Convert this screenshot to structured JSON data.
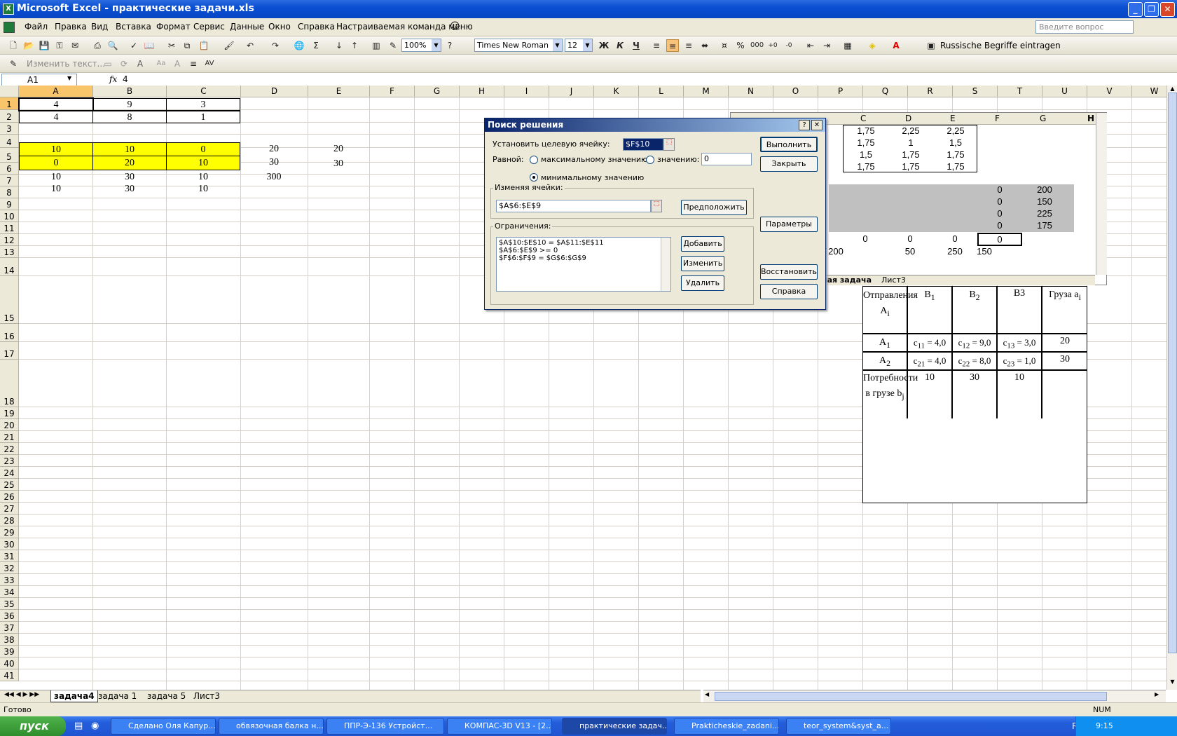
{
  "window": {
    "title": "Microsoft Excel - практические задачи.xls",
    "minimize": "_",
    "restore": "❐",
    "close": "✕"
  },
  "menu": {
    "items": [
      "Файл",
      "Правка",
      "Вид",
      "Вставка",
      "Формат",
      "Сервис",
      "Данные",
      "Окно",
      "Справка",
      "Настраиваемая команда меню"
    ],
    "ask_placeholder": "Введите вопрос"
  },
  "toolbar": {
    "zoom": "100%",
    "font": "Times New Roman",
    "size": "12",
    "bold": "Ж",
    "italic": "К",
    "underline": "Ч",
    "percent": "%",
    "thousands": "000",
    "macro": "Russische Begriffe eintragen",
    "textbox": "Изменить текст..."
  },
  "formula": {
    "cell_ref": "A1",
    "fx": "fx",
    "value": "4"
  },
  "grid": {
    "columns": [
      "A",
      "B",
      "C",
      "D",
      "E",
      "F",
      "G",
      "H",
      "I",
      "J",
      "K",
      "L",
      "M",
      "N",
      "O",
      "P",
      "Q",
      "R",
      "S",
      "T",
      "U",
      "V",
      "W"
    ],
    "rows": [
      "1",
      "2",
      "3",
      "4",
      "5",
      "6",
      "7",
      "8",
      "9",
      "10",
      "11",
      "12",
      "13",
      "14",
      "15",
      "16",
      "17",
      "18",
      "19",
      "20",
      "21",
      "22",
      "23",
      "24",
      "25",
      "26",
      "27",
      "28",
      "29",
      "30",
      "31",
      "32",
      "33",
      "34",
      "35",
      "36",
      "37",
      "38",
      "39",
      "40",
      "41"
    ],
    "r1": [
      "4",
      "9",
      "3"
    ],
    "r2": [
      "4",
      "8",
      "1"
    ],
    "r4": [
      "10",
      "10",
      "0",
      "20",
      "20"
    ],
    "r5": [
      "0",
      "20",
      "10",
      "30",
      "30"
    ],
    "r6": [
      "10",
      "30",
      "10",
      "300"
    ],
    "r7": [
      "10",
      "30",
      "10"
    ]
  },
  "bg_window": {
    "cols": [
      "C",
      "D",
      "E",
      "F",
      "G",
      "H"
    ],
    "r1": [
      "1,75",
      "2,25",
      "2,25"
    ],
    "r2": [
      "1,75",
      "1",
      "1,5"
    ],
    "r3": [
      "1,5",
      "1,75",
      "1,75"
    ],
    "r4": [
      "1,75",
      "1,75",
      "1,75"
    ],
    "right_col": [
      "0",
      "0",
      "0",
      "0"
    ],
    "g_col": [
      "200",
      "150",
      "225",
      "175"
    ],
    "r11": [
      "0",
      "0",
      "0",
      "0",
      "0"
    ],
    "r12": [
      "200",
      "50",
      "250",
      "150"
    ],
    "tabs": [
      "ная задача",
      "Лист3"
    ]
  },
  "task_table": {
    "h0": "Отправления A",
    "h0_sub": "i",
    "h1": "B",
    "h1_sub": "1",
    "h2": "B",
    "h2_sub": "2",
    "h3": "B3",
    "h4": "Груза a",
    "h4_sub": "i",
    "a1": "A",
    "a1_sub": "1",
    "a2": "A",
    "a2_sub": "2",
    "c11": "c",
    "c11_sub": "11",
    "c11_val": " = 4,0",
    "c12": "c",
    "c12_sub": "12",
    "c12_val": " = 9,0",
    "c13": "c",
    "c13_sub": "13",
    "c13_val": " = 3,0",
    "c21": "c",
    "c21_sub": "21",
    "c21_val": " = 4,0",
    "c22": "c",
    "c22_sub": "22",
    "c22_val": " = 8,0",
    "c23": "c",
    "c23_sub": "23",
    "c23_val": " = 1,0",
    "s1": "20",
    "s2": "30",
    "need": "Потребности в грузе b",
    "need_sub": "j",
    "b1": "10",
    "b2": "30",
    "b3": "10"
  },
  "dialog": {
    "title": "Поиск решения",
    "help": "?",
    "close": "✕",
    "target_label": "Установить целевую ячейку:",
    "target_value": "$F$10",
    "equal_label": "Равной:",
    "opt_max": "максимальному значению",
    "opt_value": "значению:",
    "value_input": "0",
    "opt_min": "минимальному значению",
    "changing_label": "Изменяя ячейки:",
    "changing_value": "$A$6:$E$9",
    "guess": "Предположить",
    "constraints_label": "Ограничения:",
    "constraints": [
      "$A$10:$E$10 = $A$11:$E$11",
      "$A$6:$E$9 >= 0",
      "$F$6:$F$9 = $G$6:$G$9"
    ],
    "add": "Добавить",
    "change": "Изменить",
    "delete": "Удалить",
    "solve": "Выполнить",
    "close_btn": "Закрыть",
    "options": "Параметры",
    "reset": "Восстановить",
    "help_btn": "Справка"
  },
  "sheets": [
    "задача4",
    "задача 1",
    "задача 5",
    "Лист3"
  ],
  "status": {
    "ready": "Готово",
    "num": "NUM"
  },
  "taskbar": {
    "start": "пуск",
    "tasks": [
      "Сделано Оля Капур...",
      "обвязочная балка н...",
      "ППР-Э-136 Устройст...",
      "КОМПАС-3D V13 - [2...",
      "практические задач...",
      "Prakticheskie_zadani...",
      "teor_system&syst_a..."
    ],
    "lang": "RU",
    "time": "9:15"
  }
}
